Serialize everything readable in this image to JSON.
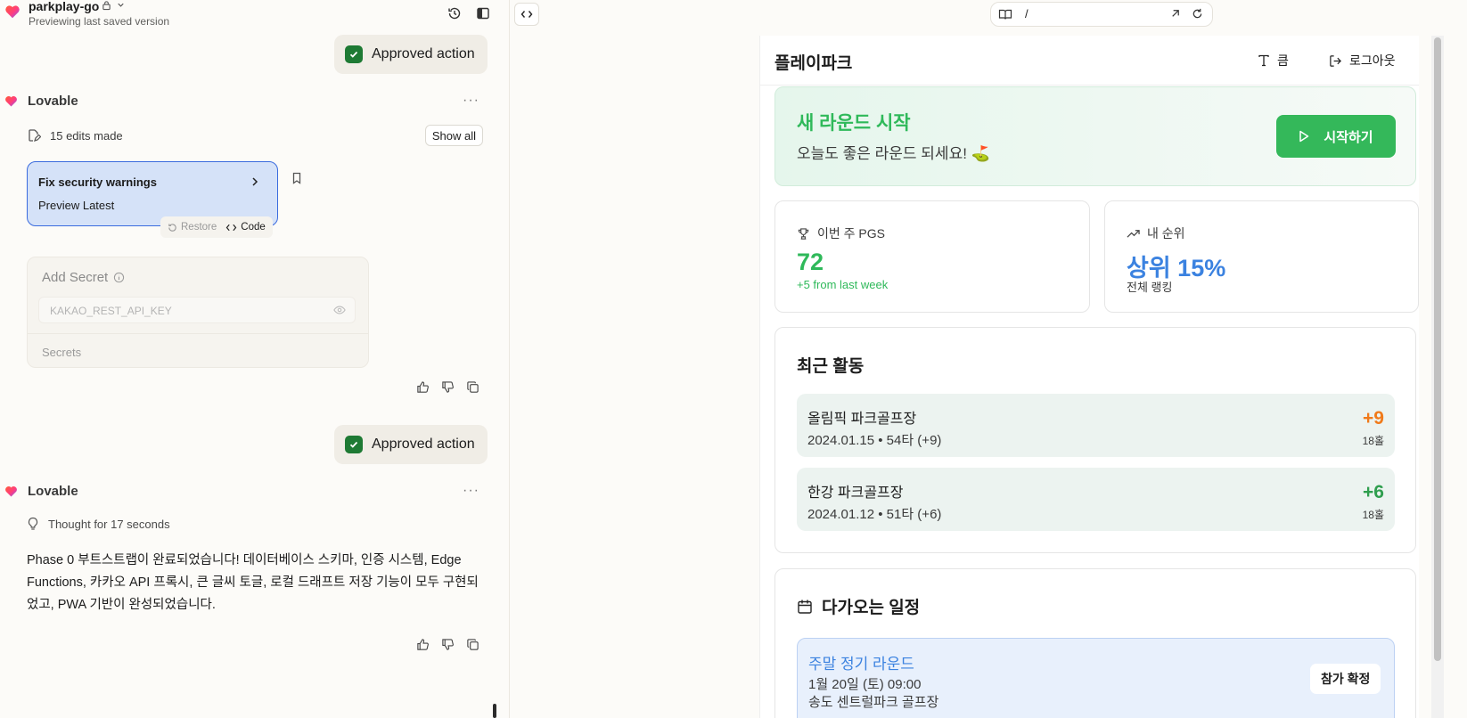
{
  "chat": {
    "project_name": "parkplay-go",
    "project_status": "Previewing last saved version",
    "approved_label": "Approved action",
    "assistant_name": "Lovable",
    "more_label": "···",
    "edits_made": "15 edits made",
    "show_all": "Show all",
    "version_card": {
      "title": "Fix security warnings",
      "subtitle": "Preview Latest",
      "restore": "Restore",
      "code": "Code"
    },
    "secret": {
      "title": "Add Secret",
      "placeholder": "KAKAO_REST_API_KEY",
      "footer": "Secrets"
    },
    "thought": "Thought for 17 seconds",
    "message": "Phase 0 부트스트랩이 완료되었습니다! 데이터베이스 스키마, 인증 시스템, Edge Functions, 카카오 API 프록시, 큰 글씨 토글, 로컬 드래프트 저장 기능이 모두 구현되었고, PWA 기반이 완성되었습니다."
  },
  "preview": {
    "url_path": "/"
  },
  "app": {
    "title": "플레이파크",
    "font_toggle": "큼",
    "logout": "로그아웃",
    "start": {
      "title": "새 라운드 시작",
      "subtitle": "오늘도 좋은 라운드 되세요! ⛳",
      "button": "시작하기"
    },
    "stats": [
      {
        "label": "이번 주 PGS",
        "value": "72",
        "sub": "+5 from last week",
        "color": "#2fb95a"
      },
      {
        "label": "내 순위",
        "value": "상위 15%",
        "sub": "전체 랭킹",
        "color": "#3b82e0"
      }
    ],
    "recent": {
      "title": "최근 활동",
      "items": [
        {
          "name": "올림픽 파크골프장",
          "meta": "2024.01.15 • 54타 (+9)",
          "score": "+9",
          "holes": "18홀",
          "color": "#f07a1a"
        },
        {
          "name": "한강 파크골프장",
          "meta": "2024.01.12 • 51타 (+6)",
          "score": "+6",
          "holes": "18홀",
          "color": "#2f9e4e"
        }
      ]
    },
    "schedule": {
      "title": "다가오는 일정",
      "item": {
        "name": "주말 정기 라운드",
        "time": "1월 20일 (토) 09:00",
        "location": "송도 센트럴파크 골프장",
        "button": "참가 확정"
      }
    }
  },
  "colors": {
    "accent_green": "#34b85a",
    "accent_blue": "#3b82e0",
    "selected_card": "#d5e2f8"
  }
}
